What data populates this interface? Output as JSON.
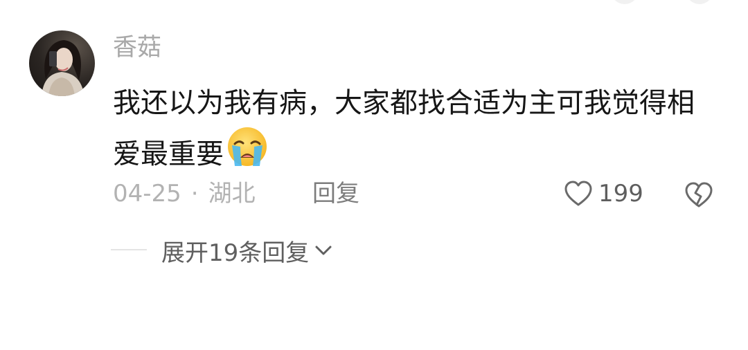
{
  "comment": {
    "username": "香菇",
    "text": "我还以为我有病，大家都找合适为主可我觉得相爱最重要",
    "emoji": "loudly-crying-face",
    "date": "04-25",
    "separator": "·",
    "location": "湖北",
    "reply_label": "回复",
    "like_count": "199",
    "expand_label": "展开19条回复"
  },
  "icons": {
    "like": "heart-outline-icon",
    "dislike": "broken-heart-icon",
    "expand": "chevron-down-icon"
  },
  "colors": {
    "username": "#a9a9a9",
    "text": "#161616",
    "meta": "#b2b2b2",
    "reply": "#7c7c7c"
  }
}
